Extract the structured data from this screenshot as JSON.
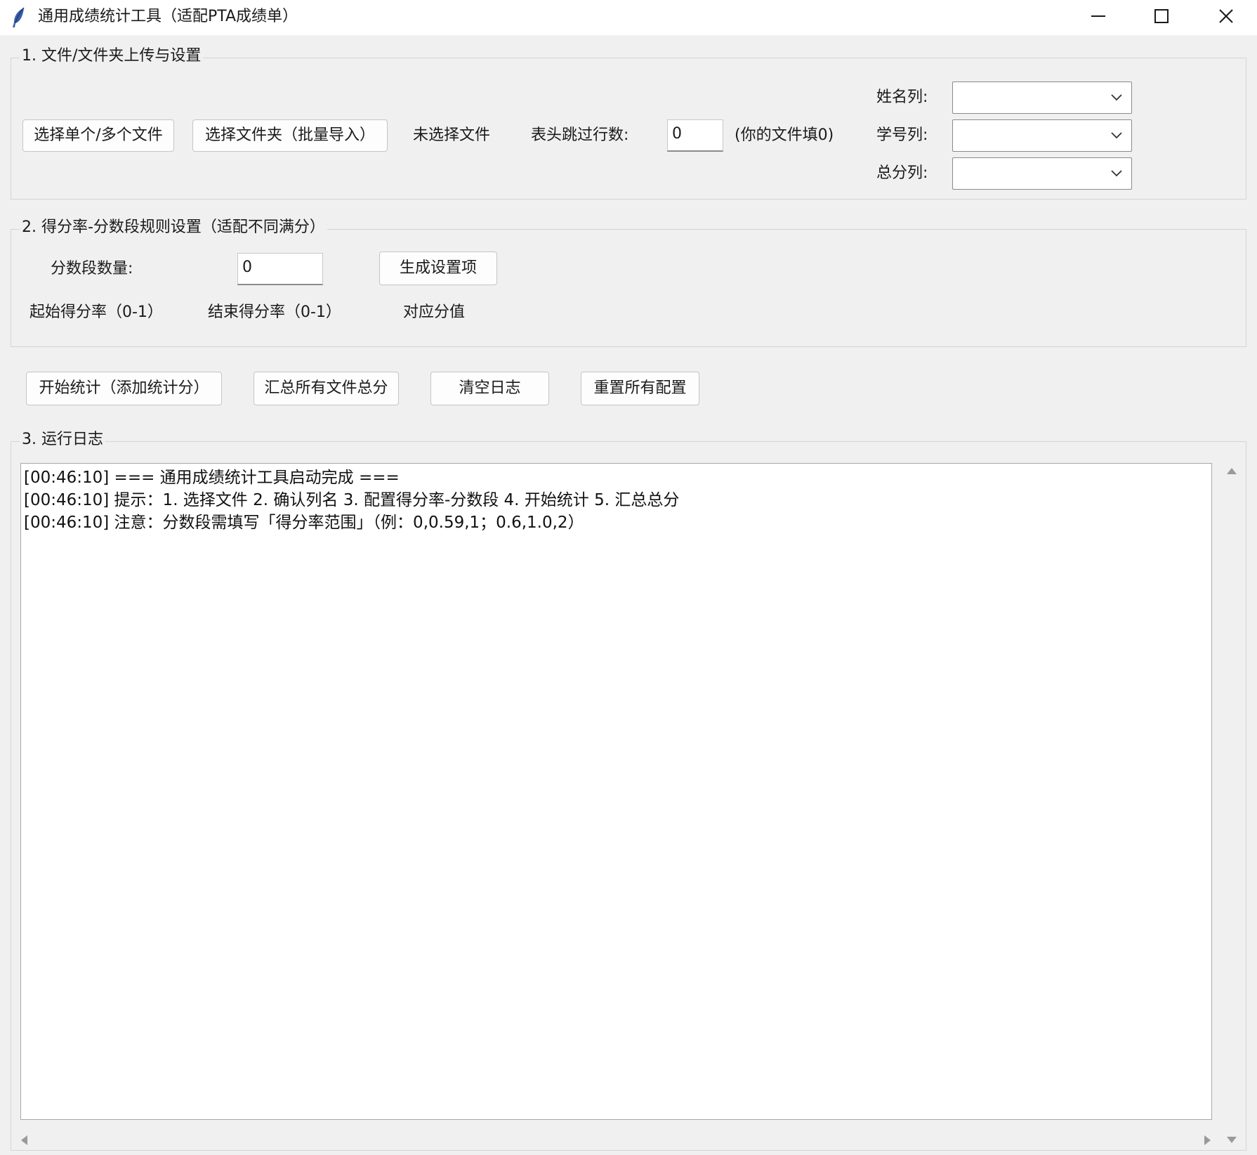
{
  "window": {
    "title": "通用成绩统计工具（适配PTA成绩单）",
    "icon": "feather-icon",
    "controls": [
      "minimize-icon",
      "maximize-icon",
      "close-icon"
    ]
  },
  "section1": {
    "title": "1. 文件/文件夹上传与设置",
    "select_files_label": "选择单个/多个文件",
    "select_folder_label": "选择文件夹（批量导入）",
    "file_status": "未选择文件",
    "skip_rows_label": "表头跳过行数:",
    "skip_rows_value": "0",
    "skip_rows_hint": "(你的文件填0)",
    "name_col_label": "姓名列:",
    "name_col_value": "",
    "id_col_label": "学号列:",
    "id_col_value": "",
    "total_col_label": "总分列:",
    "total_col_value": ""
  },
  "section2": {
    "title": "2. 得分率-分数段规则设置（适配不同满分）",
    "count_label": "分数段数量:",
    "count_value": "0",
    "generate_label": "生成设置项",
    "col_start": "起始得分率（0-1）",
    "col_end": "结束得分率（0-1）",
    "col_score": "对应分值"
  },
  "actions": {
    "start_label": "开始统计（添加统计分）",
    "summary_label": "汇总所有文件总分",
    "clear_label": "清空日志",
    "reset_label": "重置所有配置"
  },
  "section3": {
    "title": "3. 运行日志",
    "log_lines": [
      "[00:46:10] === 通用成绩统计工具启动完成 ===",
      "[00:46:10] 提示：1. 选择文件 2. 确认列名 3. 配置得分率-分数段 4. 开始统计 5. 汇总总分",
      "[00:46:10] 注意：分数段需填写「得分率范围」（例：0,0.59,1；0.6,1.0,2）"
    ]
  }
}
